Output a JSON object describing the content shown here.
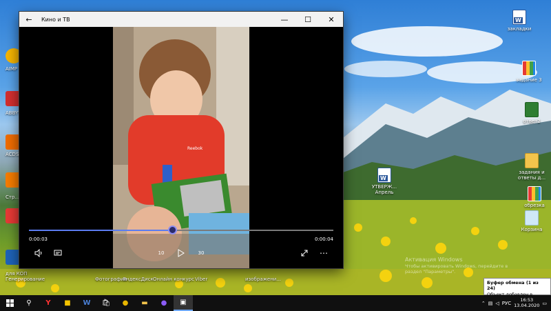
{
  "desktop": {
    "right_icons": [
      {
        "label": "закладки",
        "kind": "word"
      },
      {
        "label": "задание 3",
        "kind": "grid"
      },
      {
        "label": "ответ2",
        "kind": "green"
      },
      {
        "label": "задания и ответы д...",
        "kind": "folder"
      },
      {
        "label": "обрезка",
        "kind": "grid"
      },
      {
        "label": "Корзина",
        "kind": "recycle"
      }
    ],
    "middle_icon": {
      "label": "УТВЕРЖ... Апрель",
      "kind": "word"
    },
    "left_labels": [
      "AIMP",
      "ABBYY FineRe...",
      "ACDSee",
      "Стр...",
      "для КОП Генерирование",
      "КОП"
    ],
    "bottom_labels": [
      "Фотографии",
      "ЯндексДиск",
      "Онлайн конкурс",
      "Viber",
      "изображени..."
    ]
  },
  "window": {
    "title": "Кино и ТВ",
    "back_icon": "arrow-left-icon",
    "controls": {
      "minimize": "—",
      "maximize": "☐",
      "close": "✕"
    },
    "player": {
      "current_time": "0:00:03",
      "total_time": "0:00:04",
      "progress": 0.47,
      "skip_back_label": "10",
      "skip_forward_label": "30"
    }
  },
  "taskbar": {
    "language": "РУС",
    "time": "16:53",
    "date": "13.04.2020"
  },
  "notification": {
    "title": "Буфер обмена (1 из 24)",
    "body": "Объект добавлен в буфер."
  },
  "watermark": {
    "line1": "Активация Windows",
    "line2": "Чтобы активировать Windows, перейдите в",
    "line3": "раздел \"Параметры\"."
  }
}
